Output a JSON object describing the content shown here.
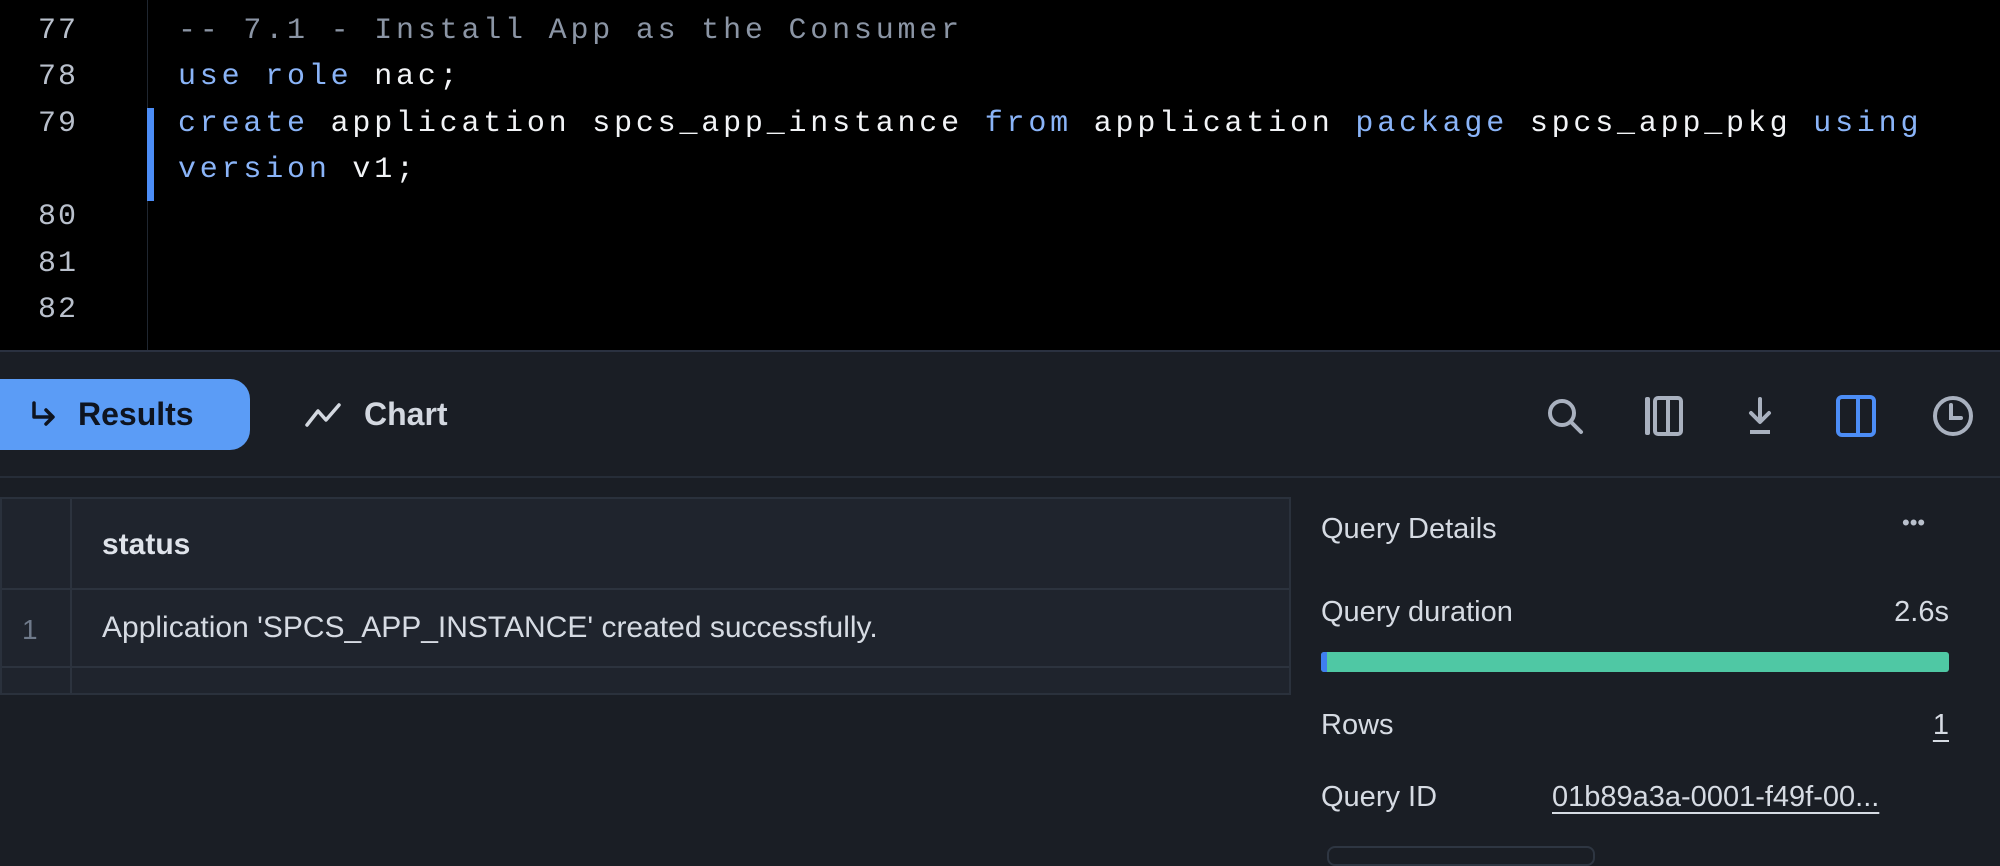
{
  "editor": {
    "lines": [
      {
        "num": "77",
        "tokens": [
          {
            "t": "-- 7.1 - Install App as the Consumer",
            "c": "cm"
          }
        ]
      },
      {
        "num": "78",
        "tokens": [
          {
            "t": "use role",
            "c": "kw"
          },
          {
            "t": " nac;",
            "c": ""
          }
        ]
      },
      {
        "num": "79",
        "tokens": [
          {
            "t": "create",
            "c": "kw"
          },
          {
            "t": " application spcs_app_instance ",
            "c": ""
          },
          {
            "t": "from",
            "c": "kw"
          },
          {
            "t": " application ",
            "c": ""
          },
          {
            "t": "package",
            "c": "kw"
          },
          {
            "t": " spcs_app_pkg ",
            "c": ""
          },
          {
            "t": "using",
            "c": "kw"
          }
        ]
      },
      {
        "num": "",
        "tokens": [
          {
            "t": "version",
            "c": "kw"
          },
          {
            "t": " v1;",
            "c": ""
          }
        ]
      },
      {
        "num": "80",
        "tokens": []
      },
      {
        "num": "81",
        "tokens": []
      },
      {
        "num": "82",
        "tokens": []
      }
    ]
  },
  "tabs": {
    "results": "Results",
    "chart": "Chart",
    "results_icon": "return-arrow-icon",
    "chart_icon": "line-chart-icon"
  },
  "toolbar": {
    "icons": [
      "search-icon",
      "columns-icon",
      "download-icon",
      "split-panel-icon",
      "history-clock-icon"
    ],
    "active": "split-panel-icon"
  },
  "table": {
    "columns": [
      "status"
    ],
    "rows": [
      {
        "num": "1",
        "status": "Application 'SPCS_APP_INSTANCE' created successfully."
      }
    ]
  },
  "details": {
    "title": "Query Details",
    "more": "•••",
    "duration_label": "Query duration",
    "duration_value": "2.6s",
    "duration_bar": {
      "compile_fraction": 0.01,
      "execution_fraction": 0.99,
      "colors": {
        "compile": "#3f7ef0",
        "execution": "#4fc8a4"
      }
    },
    "rows_label": "Rows",
    "rows_value": "1",
    "query_id_label": "Query ID",
    "query_id_value": "01b89a3a-0001-f49f-00..."
  },
  "colors": {
    "accent": "#5b9cf6",
    "keyword": "#8ab4f8",
    "comment": "#8b95a5"
  }
}
